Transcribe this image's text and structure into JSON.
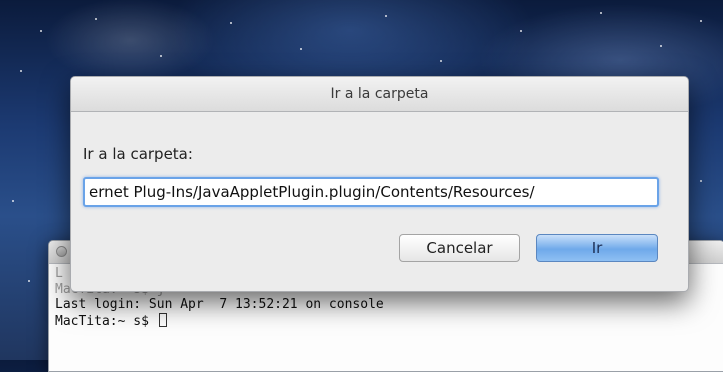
{
  "dialog": {
    "title": "Ir a la carpeta",
    "field_label": "Ir a la carpeta:",
    "path_value": "ernet Plug-Ins/JavaAppletPlugin.plugin/Contents/Resources/",
    "cancel_label": "Cancelar",
    "go_label": "Ir"
  },
  "terminal": {
    "lines": [
      "L",
      "MacTita:~ s$ j",
      "Last login: Sun Apr  7 13:52:21 on console",
      "MacTita:~ s$ "
    ]
  },
  "colors": {
    "accent": "#6fa9ea",
    "focus_ring": "#6aa3e8"
  }
}
